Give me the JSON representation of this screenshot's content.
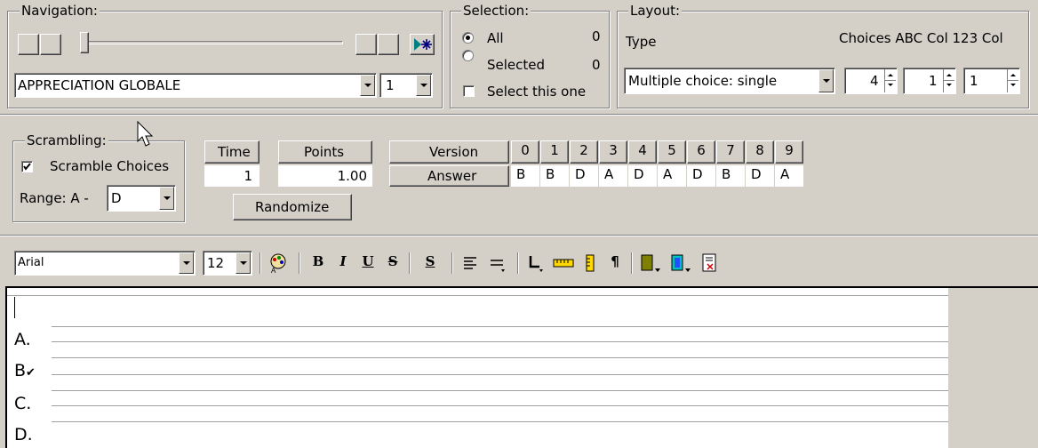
{
  "navigation": {
    "legend": "Navigation:",
    "question_select_value": "APPRECIATION GLOBALE",
    "number_select_value": "1",
    "jump_icon": "star-arrow-icon"
  },
  "selection": {
    "legend": "Selection:",
    "all_label": "All",
    "all_count": "0",
    "selected_label": "Selected",
    "selected_count": "0",
    "select_this_label": "Select this one"
  },
  "layout": {
    "legend": "Layout:",
    "type_label": "Type",
    "columns_header": "Choices ABC Col 123 Col",
    "type_value": "Multiple choice: single",
    "choices_value": "4",
    "abc_col_value": "1",
    "col123_value": "1"
  },
  "scrambling": {
    "legend": "Scrambling:",
    "scramble_label": "Scramble Choices",
    "range_label": "Range: A -",
    "range_value": "D"
  },
  "scoring": {
    "time_header": "Time",
    "time_value": "1",
    "points_header": "Points",
    "points_value": "1.00",
    "randomize_label": "Randomize"
  },
  "versions": {
    "version_label": "Version",
    "answer_label": "Answer",
    "numbers": [
      "0",
      "1",
      "2",
      "3",
      "4",
      "5",
      "6",
      "7",
      "8",
      "9"
    ],
    "answers": [
      "B",
      "B",
      "D",
      "A",
      "D",
      "A",
      "D",
      "B",
      "D",
      "A"
    ]
  },
  "format_toolbar": {
    "font_value": "Arial",
    "size_value": "12",
    "bold": "B",
    "italic": "I",
    "underline": "U",
    "strike": "S",
    "style": "S",
    "pilcrow": "¶"
  },
  "editor": {
    "choices": [
      "A.",
      "B",
      "C.",
      "D."
    ],
    "correct_mark": "✔"
  },
  "colors": {
    "face": "#d4d0c8",
    "shadow": "#808080",
    "highlight": "#ffffff",
    "nav_blue": "#000080"
  }
}
